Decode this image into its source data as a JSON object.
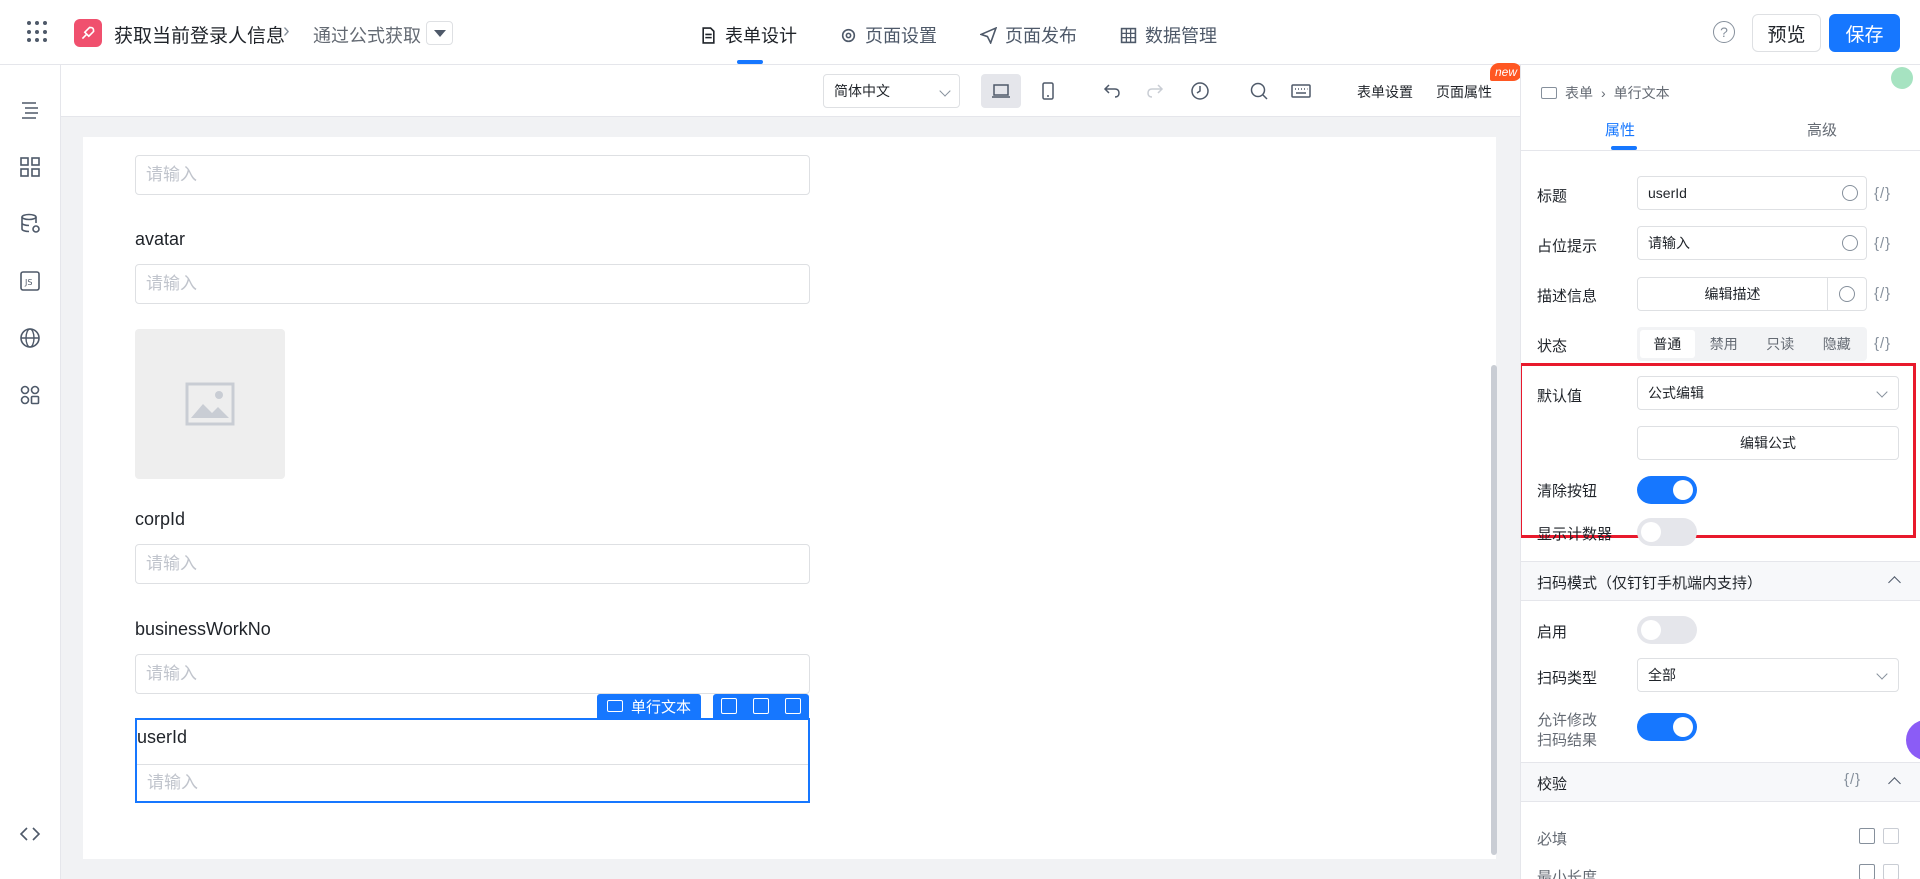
{
  "header": {
    "app_title": "获取当前登录人信息",
    "sub_title": "通过公式获取",
    "tabs": [
      {
        "label": "表单设计",
        "icon": "document-icon",
        "active": true
      },
      {
        "label": "页面设置",
        "icon": "gear-icon",
        "active": false
      },
      {
        "label": "页面发布",
        "icon": "send-icon",
        "active": false
      },
      {
        "label": "数据管理",
        "icon": "table-icon",
        "active": false
      }
    ],
    "help": "?",
    "preview_label": "预览",
    "save_label": "保存",
    "accent_color": "#1677ff"
  },
  "sidebar": {
    "icons": [
      "outline-icon",
      "components-icon",
      "datasource-icon",
      "js-icon",
      "globe-icon",
      "plugins-icon",
      "code-icon"
    ]
  },
  "toolbar": {
    "language": "简体中文",
    "form_settings": "表单设置",
    "page_properties": "页面属性",
    "new_badge": "new"
  },
  "canvas": {
    "placeholder": "请输入",
    "fields": [
      {
        "label": "avatar"
      },
      {
        "label": "corpId"
      },
      {
        "label": "businessWorkNo"
      },
      {
        "label": "userId"
      }
    ],
    "selected_tag": "单行文本"
  },
  "panel": {
    "breadcrumb": [
      "表单",
      "单行文本"
    ],
    "tabs": [
      "属性",
      "高级"
    ],
    "fx": "{/}",
    "title_label": "标题",
    "title_value": "userId",
    "placeholder_label": "占位提示",
    "placeholder_value": "请输入",
    "desc_label": "描述信息",
    "desc_button": "编辑描述",
    "state_label": "状态",
    "state_options": [
      "普通",
      "禁用",
      "只读",
      "隐藏"
    ],
    "state_selected": "普通",
    "default_label": "默认值",
    "default_value": "公式编辑",
    "edit_formula": "编辑公式",
    "clear_label": "清除按钮",
    "clear_on": true,
    "counter_label": "显示计数器",
    "counter_on": false,
    "scan_section": "扫码模式（仅钉钉手机端内支持）",
    "enable_label": "启用",
    "enable_on": false,
    "scan_type_label": "扫码类型",
    "scan_type_value": "全部",
    "allow_modify_label_1": "允许修改",
    "allow_modify_label_2": "扫码结果",
    "allow_modify_on": true,
    "validation_section": "校验",
    "required_label": "必填",
    "min_length_label": "最小长度",
    "highlight_color": "#e8192c"
  }
}
